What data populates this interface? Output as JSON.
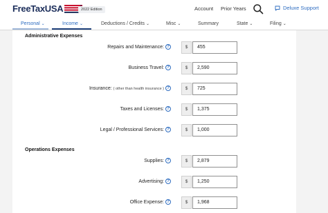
{
  "header": {
    "logo_text": "FreeTaxUSA",
    "edition": "2022 Edition",
    "links": [
      "Account",
      "Prior Years"
    ],
    "search_icon": "search-icon",
    "support_label": "Deluxe Support",
    "support_icon": "chat-icon"
  },
  "nav": {
    "items": [
      {
        "label": "Personal"
      },
      {
        "label": "Income"
      },
      {
        "label": "Deductions / Credits"
      },
      {
        "label": "Misc"
      },
      {
        "label": "Summary"
      },
      {
        "label": "State"
      },
      {
        "label": "Filing"
      }
    ],
    "active": "Income"
  },
  "sections": [
    {
      "title": "Administrative Expenses",
      "rows": [
        {
          "label": "Repairs and Maintenance:",
          "currency": "$",
          "value": "455"
        },
        {
          "label": "Business Travel:",
          "currency": "$",
          "value": "2,590"
        },
        {
          "label": "Insurance:",
          "note": "( other than health insurance )",
          "currency": "$",
          "value": "725"
        },
        {
          "label": "Taxes and Licenses:",
          "currency": "$",
          "value": "1,375"
        },
        {
          "label": "Legal / Professional Services:",
          "currency": "$",
          "value": "1,000"
        }
      ]
    },
    {
      "title": "Operations Expenses",
      "rows": [
        {
          "label": "Supplies:",
          "currency": "$",
          "value": "2,879"
        },
        {
          "label": "Advertising:",
          "currency": "$",
          "value": "1,250"
        },
        {
          "label": "Office Expense:",
          "currency": "$",
          "value": "1,968"
        }
      ]
    }
  ],
  "colors": {
    "brand_navy": "#1b2d5a",
    "link_blue": "#2d6cc0",
    "flag_red": "#c8102e"
  }
}
